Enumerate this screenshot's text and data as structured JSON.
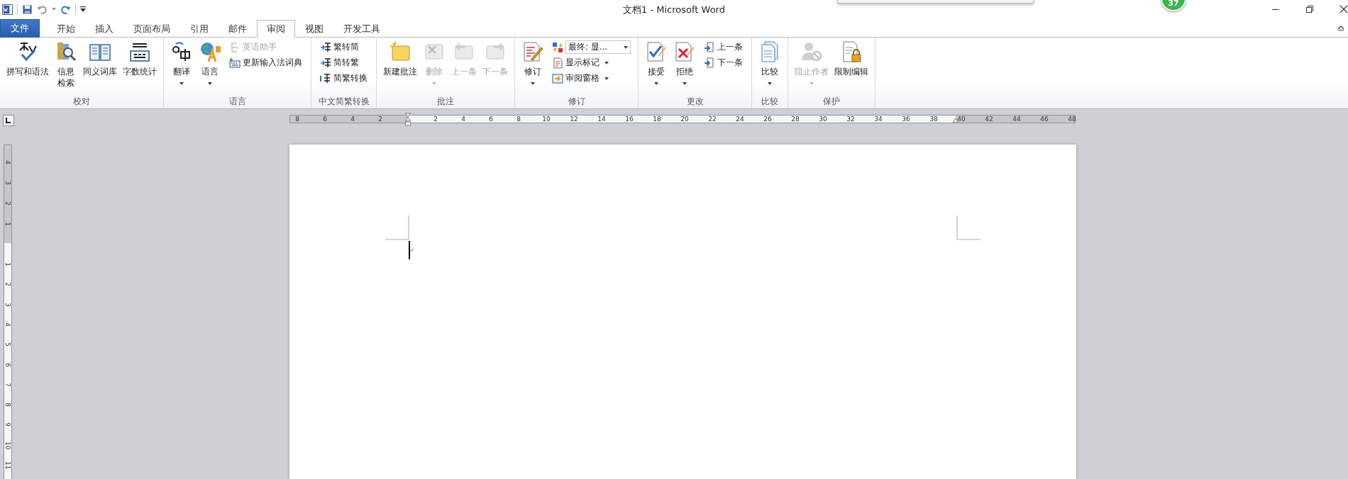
{
  "title_bar": {
    "title": "文档1 - Microsoft Word",
    "badge": "37"
  },
  "tabs": [
    {
      "label": "文件",
      "kind": "file",
      "selected": false
    },
    {
      "label": "开始",
      "kind": "tab",
      "selected": false
    },
    {
      "label": "插入",
      "kind": "tab",
      "selected": false
    },
    {
      "label": "页面布局",
      "kind": "tab",
      "selected": false
    },
    {
      "label": "引用",
      "kind": "tab",
      "selected": false
    },
    {
      "label": "邮件",
      "kind": "tab",
      "selected": false
    },
    {
      "label": "审阅",
      "kind": "tab",
      "selected": true
    },
    {
      "label": "视图",
      "kind": "tab",
      "selected": false
    },
    {
      "label": "开发工具",
      "kind": "tab",
      "selected": false
    }
  ],
  "ribbon_groups": [
    {
      "label": "校对",
      "items": [
        {
          "kind": "large",
          "label": "拼写和语法",
          "disabled": false,
          "menu": false,
          "wrap": false
        },
        {
          "kind": "large",
          "label": "信息检索",
          "disabled": false,
          "menu": false,
          "wrap": true
        },
        {
          "kind": "large",
          "label": "同义词库",
          "disabled": false,
          "menu": false,
          "wrap": false
        },
        {
          "kind": "large",
          "label": "字数统计",
          "disabled": false,
          "menu": false,
          "wrap": false
        }
      ]
    },
    {
      "label": "语言",
      "items": [
        {
          "kind": "large",
          "label": "翻译",
          "disabled": false,
          "menu": true,
          "wrap": false
        },
        {
          "kind": "large",
          "label": "语言",
          "disabled": false,
          "menu": true,
          "wrap": false
        },
        {
          "kind": "stack",
          "items": [
            {
              "kind": "small",
              "label": "英语助手",
              "disabled": true,
              "menu": false
            },
            {
              "kind": "small",
              "label": "更新输入法词典",
              "disabled": false,
              "menu": false
            }
          ]
        }
      ]
    },
    {
      "label": "中文简繁转换",
      "items": [
        {
          "kind": "stack",
          "items": [
            {
              "kind": "small",
              "label": "繁转简",
              "disabled": false,
              "menu": false
            },
            {
              "kind": "small",
              "label": "简转繁",
              "disabled": false,
              "menu": false
            },
            {
              "kind": "small",
              "label": "简繁转换",
              "disabled": false,
              "menu": false
            }
          ]
        }
      ]
    },
    {
      "label": "批注",
      "items": [
        {
          "kind": "large",
          "label": "新建批注",
          "disabled": false,
          "menu": false,
          "wrap": false
        },
        {
          "kind": "large",
          "label": "删除",
          "disabled": true,
          "menu": true,
          "wrap": false
        },
        {
          "kind": "large",
          "label": "上一条",
          "disabled": true,
          "menu": false,
          "wrap": false
        },
        {
          "kind": "large",
          "label": "下一条",
          "disabled": true,
          "menu": false,
          "wrap": false
        }
      ]
    },
    {
      "label": "修订",
      "items": [
        {
          "kind": "large",
          "label": "修订",
          "disabled": false,
          "menu": true,
          "wrap": false
        },
        {
          "kind": "stack",
          "items": [
            {
              "kind": "select",
              "value": "最终: 显..."
            },
            {
              "kind": "small",
              "label": "显示标记",
              "disabled": false,
              "menu": true
            },
            {
              "kind": "small",
              "label": "审阅窗格",
              "disabled": false,
              "menu": true
            }
          ]
        }
      ]
    },
    {
      "label": "更改",
      "items": [
        {
          "kind": "large",
          "label": "接受",
          "disabled": false,
          "menu": true,
          "wrap": false
        },
        {
          "kind": "large",
          "label": "拒绝",
          "disabled": false,
          "menu": true,
          "wrap": false
        },
        {
          "kind": "stack",
          "items": [
            {
              "kind": "small",
              "label": "上一条",
              "disabled": false,
              "menu": false
            },
            {
              "kind": "small",
              "label": "下一条",
              "disabled": false,
              "menu": false
            }
          ]
        }
      ]
    },
    {
      "label": "比较",
      "items": [
        {
          "kind": "large",
          "label": "比较",
          "disabled": false,
          "menu": true,
          "wrap": false
        }
      ]
    },
    {
      "label": "保护",
      "items": [
        {
          "kind": "large",
          "label": "阻止作者",
          "disabled": true,
          "menu": true,
          "wrap": false
        },
        {
          "kind": "large",
          "label": "限制编辑",
          "disabled": false,
          "menu": false,
          "wrap": false
        }
      ]
    }
  ],
  "horizontal_ruler": {
    "left_margin_labels": [
      "8",
      "6",
      "4",
      "2"
    ],
    "body_labels": [
      "2",
      "4",
      "6",
      "8",
      "10",
      "12",
      "14",
      "16",
      "18",
      "20",
      "22",
      "24",
      "26",
      "28",
      "30",
      "32",
      "34",
      "36",
      "38"
    ],
    "right_margin_labels": [
      "40",
      "42",
      "44",
      "46",
      "48"
    ]
  },
  "vertical_ruler": {
    "top_margin_labels": [
      "4",
      "3",
      "2",
      "1"
    ],
    "body_labels": [
      "1",
      "2",
      "3",
      "4",
      "5",
      "6",
      "7",
      "8",
      "9",
      "10",
      "11"
    ]
  }
}
